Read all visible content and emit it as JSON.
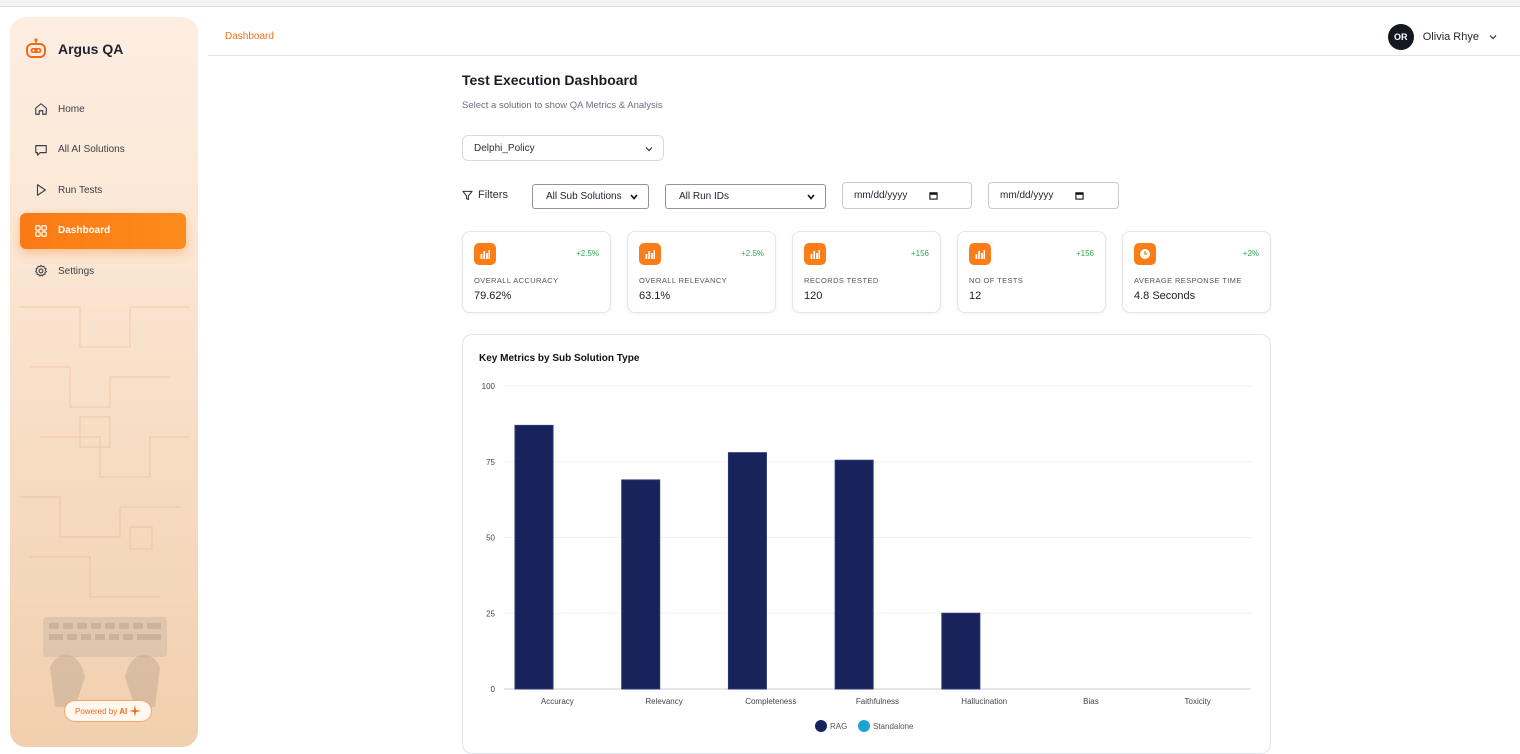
{
  "app": {
    "name": "Argus QA"
  },
  "sidebar": {
    "items": [
      {
        "label": "Home",
        "icon": "home-icon"
      },
      {
        "label": "All AI Solutions",
        "icon": "chat-icon"
      },
      {
        "label": "Run Tests",
        "icon": "play-icon"
      },
      {
        "label": "Dashboard",
        "icon": "grid-icon",
        "active": true
      },
      {
        "label": "Settings",
        "icon": "gear-icon"
      }
    ],
    "powered_prefix": "Powered by",
    "powered_ai": "AI"
  },
  "header": {
    "breadcrumb": "Dashboard",
    "user_initials": "OR",
    "user_name": "Olivia Rhye"
  },
  "main": {
    "title": "Test Execution Dashboard",
    "subtitle": "Select a solution to show QA Metrics & Analysis",
    "solution_value": "Delphi_Policy",
    "filters_label": "Filters",
    "sub_solution_value": "All Sub Solutions",
    "run_id_value": "All Run IDs",
    "date_from_placeholder": "mm/dd/yyyy",
    "date_to_placeholder": "mm/dd/yyyy"
  },
  "kpis": [
    {
      "label": "OVERALL ACCURACY",
      "value": "79.62%",
      "delta": "+2.5%",
      "icon": "bar-chart-icon"
    },
    {
      "label": "OVERALL RELEVANCY",
      "value": "63.1%",
      "delta": "+2.5%",
      "icon": "bar-chart-icon"
    },
    {
      "label": "RECORDS TESTED",
      "value": "120",
      "delta": "+156",
      "icon": "bar-chart-icon"
    },
    {
      "label": "NO OF TESTS",
      "value": "12",
      "delta": "+156",
      "icon": "bar-chart-icon"
    },
    {
      "label": "AVERAGE RESPONSE TIME",
      "value": "4.8 Seconds",
      "delta": "+2%",
      "icon": "clock-icon"
    }
  ],
  "colors": {
    "accent": "#fb7d17",
    "positive": "#2faa55",
    "rag": "#17235a",
    "standalone": "#1ba3d6"
  },
  "chart_data": {
    "type": "bar",
    "title": "Key Metrics by Sub Solution Type",
    "categories": [
      "Accuracy",
      "Relevancy",
      "Completeness",
      "Faithfulness",
      "Hallucination",
      "Bias",
      "Toxicity"
    ],
    "series": [
      {
        "name": "RAG",
        "values": [
          87,
          69,
          78,
          75.5,
          25,
          0,
          0
        ]
      },
      {
        "name": "Standalone",
        "values": [
          0,
          0,
          0,
          0,
          0,
          0,
          0
        ]
      }
    ],
    "yticks": [
      "0",
      "25",
      "50",
      "75",
      "100"
    ],
    "ylim": [
      0,
      100
    ],
    "grid": true,
    "legend": "bottom"
  }
}
